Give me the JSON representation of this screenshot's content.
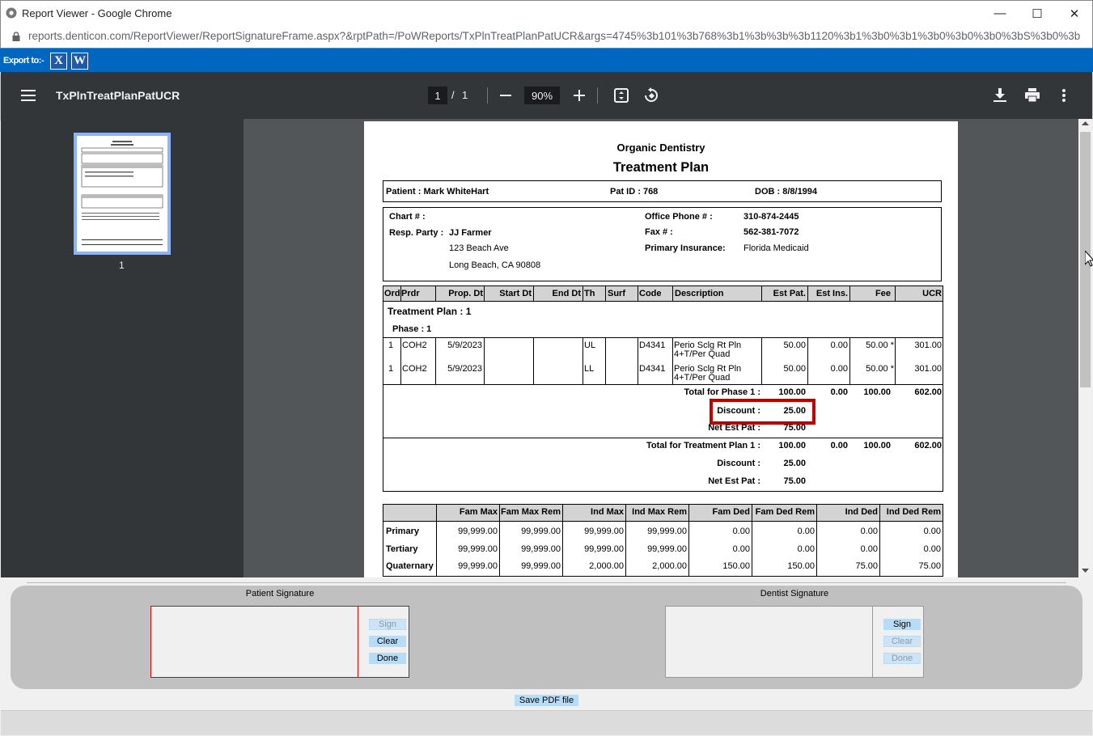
{
  "window": {
    "title": "Report Viewer - Google Chrome",
    "minimize": "—",
    "maximize": "☐",
    "close": "✕"
  },
  "address": {
    "url": "reports.denticon.com/ReportViewer/ReportSignatureFrame.aspx?&rptPath=/PoWReports/TxPlnTreatPlanPatUCR&args=4745%3b101%3b768%3b1%3b%3b%3b1120%3b1%3b0%3b1%3b0%3b0%3b0%3bS%3b0%3b..."
  },
  "export": {
    "label": "Export to:-",
    "excel": "X",
    "word": "W"
  },
  "pdf": {
    "title": "TxPlnTreatPlanPatUCR",
    "page_current": "1",
    "page_sep": "/",
    "page_total": "1",
    "zoom": "90%",
    "thumb_label": "1"
  },
  "report": {
    "company": "Organic Dentistry",
    "title": "Treatment Plan",
    "patient": "Patient : Mark  WhiteHart",
    "pat_id": "Pat ID : 768",
    "dob": "DOB : 8/8/1994",
    "chart_label": "Chart # :",
    "resp_label": "Resp. Party :",
    "resp_name": "JJ  Farmer",
    "addr1": "123 Beach Ave",
    "addr2": "Long Beach, CA 90808",
    "office_label": "Office Phone # :",
    "office_val": "310-874-2445",
    "fax_label": "Fax # :",
    "fax_val": "562-381-7072",
    "ins_label": "Primary Insurance:",
    "ins_val": "Florida Medicaid",
    "columns": [
      "Ord",
      "Prdr",
      "Prop. Dt",
      "Start Dt",
      "End Dt",
      "Th",
      "Surf",
      "Code",
      "Description",
      "Est Pat.",
      "Est Ins.",
      "Fee",
      "UCR"
    ],
    "plan_label": "Treatment Plan : 1",
    "phase_label": "Phase : 1",
    "rows": [
      {
        "ord": "1",
        "prdr": "COH2",
        "prop": "5/9/2023",
        "th": "UL",
        "code": "D4341",
        "desc1": "Perio Sclg Rt Pln",
        "desc2": "4+T/Per Quad",
        "estpat": "50.00",
        "estins": "0.00",
        "fee": "50.00 *",
        "ucr": "301.00"
      },
      {
        "ord": "1",
        "prdr": "COH2",
        "prop": "5/9/2023",
        "th": "LL",
        "code": "D4341",
        "desc1": "Perio Sclg Rt Pln",
        "desc2": "4+T/Per Quad",
        "estpat": "50.00",
        "estins": "0.00",
        "fee": "50.00 *",
        "ucr": "301.00"
      }
    ],
    "phase_total": {
      "label": "Total for Phase 1 :",
      "estpat": "100.00",
      "estins": "0.00",
      "fee": "100.00",
      "ucr": "602.00"
    },
    "phase_discount": {
      "label": "Discount :",
      "val": "25.00"
    },
    "phase_net": {
      "label": "Net Est Pat :",
      "val": "75.00"
    },
    "plan_total": {
      "label": "Total for Treatment Plan 1 :",
      "estpat": "100.00",
      "estins": "0.00",
      "fee": "100.00",
      "ucr": "602.00"
    },
    "plan_discount": {
      "label": "Discount :",
      "val": "25.00"
    },
    "plan_net": {
      "label": "Net Est Pat :",
      "val": "75.00"
    },
    "ins_columns": [
      "Fam Max",
      "Fam Max Rem",
      "Ind Max",
      "Ind Max Rem",
      "Fam Ded",
      "Fam Ded Rem",
      "Ind Ded",
      "Ind Ded Rem"
    ],
    "ins_rows": [
      {
        "name": "Primary",
        "vals": [
          "99,999.00",
          "99,999.00",
          "99,999.00",
          "99,999.00",
          "0.00",
          "0.00",
          "0.00",
          "0.00"
        ]
      },
      {
        "name": "Tertiary",
        "vals": [
          "99,999.00",
          "99,999.00",
          "99,999.00",
          "99,999.00",
          "0.00",
          "0.00",
          "0.00",
          "0.00"
        ]
      },
      {
        "name": "Quaternary",
        "vals": [
          "99,999.00",
          "99,999.00",
          "2,000.00",
          "2,000.00",
          "150.00",
          "150.00",
          "75.00",
          "75.00"
        ]
      }
    ]
  },
  "signature": {
    "patient_label": "Patient Signature",
    "dentist_label": "Dentist Signature",
    "sign": "Sign",
    "clear": "Clear",
    "done": "Done",
    "save": "Save PDF file"
  },
  "colors": {
    "export_bar": "#0067c0",
    "pdf_toolbar": "#323639",
    "highlight": "#c00000"
  }
}
